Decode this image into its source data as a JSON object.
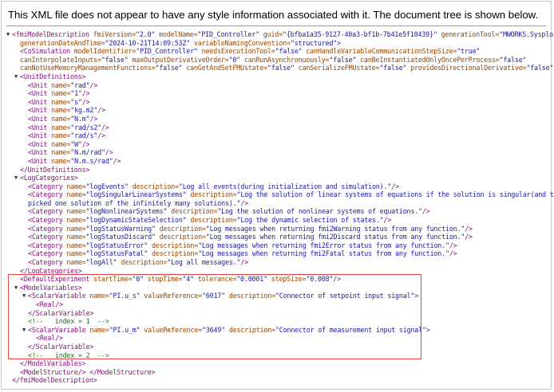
{
  "banner": "This XML file does not appear to have any style information associated with it. The document tree is shown below.",
  "lines": [
    {
      "indent": 0,
      "toggle": "▼",
      "parts": [
        [
          "tag",
          "<fmiModelDescription "
        ],
        [
          "an",
          "fmiVersion="
        ],
        [
          "av",
          "\"2.0\""
        ],
        [
          "an",
          " modelName="
        ],
        [
          "av",
          "\"PID_Controller\""
        ],
        [
          "an",
          " guid="
        ],
        [
          "av",
          "\"{bfba1a35-9127-40a3-bf1b-7b41e5f10439}\""
        ],
        [
          "an",
          " generationTool="
        ],
        [
          "av",
          "\"MWORKS.Sysplorer\""
        ]
      ]
    },
    {
      "indent": 1,
      "toggle": "",
      "parts": [
        [
          "an",
          "generationDateAndTime="
        ],
        [
          "av",
          "\"2024-10-21T14:09:53Z\""
        ],
        [
          "an",
          " variableNamingConvention="
        ],
        [
          "av",
          "\"structured\""
        ],
        [
          "tag",
          ">"
        ]
      ]
    },
    {
      "indent": 1,
      "toggle": "",
      "parts": [
        [
          "tag",
          "<CoSimulation "
        ],
        [
          "an",
          "modelIdentifier="
        ],
        [
          "av",
          "\"PID_Controller\""
        ],
        [
          "an",
          " needsExecutionTool="
        ],
        [
          "av",
          "\"false\""
        ],
        [
          "an",
          " canHandleVariableCommunicationStepSize="
        ],
        [
          "av",
          "\"true\""
        ]
      ]
    },
    {
      "indent": 1,
      "toggle": "",
      "parts": [
        [
          "an",
          "canInterpolateInputs="
        ],
        [
          "av",
          "\"false\""
        ],
        [
          "an",
          " maxOutputDerivativeOrder="
        ],
        [
          "av",
          "\"0\""
        ],
        [
          "an",
          " canRunAsynchronuously="
        ],
        [
          "av",
          "\"false\""
        ],
        [
          "an",
          " canBeInstantiatedOnlyOncePerProcess="
        ],
        [
          "av",
          "\"false\""
        ]
      ]
    },
    {
      "indent": 1,
      "toggle": "",
      "parts": [
        [
          "an",
          "canNotUseMemoryManagementFunctions="
        ],
        [
          "av",
          "\"false\""
        ],
        [
          "an",
          " canGetAndSetFMUstate="
        ],
        [
          "av",
          "\"false\""
        ],
        [
          "an",
          " canSerializeFMUstate="
        ],
        [
          "av",
          "\"false\""
        ],
        [
          "an",
          " providesDirectionalDerivative="
        ],
        [
          "av",
          "\"false\""
        ],
        [
          "tag",
          "/>"
        ]
      ]
    },
    {
      "indent": 1,
      "toggle": "▼",
      "parts": [
        [
          "tag",
          "<UnitDefinitions>"
        ]
      ]
    },
    {
      "indent": 2,
      "toggle": "",
      "parts": [
        [
          "tag",
          "<Unit "
        ],
        [
          "an",
          "name="
        ],
        [
          "av",
          "\"rad\""
        ],
        [
          "tag",
          "/>"
        ]
      ]
    },
    {
      "indent": 2,
      "toggle": "",
      "parts": [
        [
          "tag",
          "<Unit "
        ],
        [
          "an",
          "name="
        ],
        [
          "av",
          "\"1\""
        ],
        [
          "tag",
          "/>"
        ]
      ]
    },
    {
      "indent": 2,
      "toggle": "",
      "parts": [
        [
          "tag",
          "<Unit "
        ],
        [
          "an",
          "name="
        ],
        [
          "av",
          "\"s\""
        ],
        [
          "tag",
          "/>"
        ]
      ]
    },
    {
      "indent": 2,
      "toggle": "",
      "parts": [
        [
          "tag",
          "<Unit "
        ],
        [
          "an",
          "name="
        ],
        [
          "av",
          "\"kg.m2\""
        ],
        [
          "tag",
          "/>"
        ]
      ]
    },
    {
      "indent": 2,
      "toggle": "",
      "parts": [
        [
          "tag",
          "<Unit "
        ],
        [
          "an",
          "name="
        ],
        [
          "av",
          "\"N.m\""
        ],
        [
          "tag",
          "/>"
        ]
      ]
    },
    {
      "indent": 2,
      "toggle": "",
      "parts": [
        [
          "tag",
          "<Unit "
        ],
        [
          "an",
          "name="
        ],
        [
          "av",
          "\"rad/s2\""
        ],
        [
          "tag",
          "/>"
        ]
      ]
    },
    {
      "indent": 2,
      "toggle": "",
      "parts": [
        [
          "tag",
          "<Unit "
        ],
        [
          "an",
          "name="
        ],
        [
          "av",
          "\"rad/s\""
        ],
        [
          "tag",
          "/>"
        ]
      ]
    },
    {
      "indent": 2,
      "toggle": "",
      "parts": [
        [
          "tag",
          "<Unit "
        ],
        [
          "an",
          "name="
        ],
        [
          "av",
          "\"W\""
        ],
        [
          "tag",
          "/>"
        ]
      ]
    },
    {
      "indent": 2,
      "toggle": "",
      "parts": [
        [
          "tag",
          "<Unit "
        ],
        [
          "an",
          "name="
        ],
        [
          "av",
          "\"N.m/rad\""
        ],
        [
          "tag",
          "/>"
        ]
      ]
    },
    {
      "indent": 2,
      "toggle": "",
      "parts": [
        [
          "tag",
          "<Unit "
        ],
        [
          "an",
          "name="
        ],
        [
          "av",
          "\"N.m.s/rad\""
        ],
        [
          "tag",
          "/>"
        ]
      ]
    },
    {
      "indent": 1,
      "toggle": "",
      "parts": [
        [
          "tag",
          "</UnitDefinitions>"
        ]
      ]
    },
    {
      "indent": 1,
      "toggle": "▼",
      "parts": [
        [
          "tag",
          "<LogCategories>"
        ]
      ]
    },
    {
      "indent": 2,
      "toggle": "",
      "parts": [
        [
          "tag",
          "<Category "
        ],
        [
          "an",
          "name="
        ],
        [
          "av",
          "\"logEvents\""
        ],
        [
          "an",
          " description="
        ],
        [
          "av",
          "\"Log all events(during initialization and simulation).\""
        ],
        [
          "tag",
          "/>"
        ]
      ]
    },
    {
      "indent": 2,
      "toggle": "",
      "parts": [
        [
          "tag",
          "<Category "
        ],
        [
          "an",
          "name="
        ],
        [
          "av",
          "\"logSingularLinearSystems\""
        ],
        [
          "an",
          " description="
        ],
        [
          "av",
          "\"Log the solution of linear systems of equations if the solution is singular(and the tool"
        ]
      ]
    },
    {
      "indent": 2,
      "toggle": "",
      "parts": [
        [
          "av",
          "picked one solution of the infinitely many solutions).\""
        ],
        [
          "tag",
          "/>"
        ]
      ]
    },
    {
      "indent": 2,
      "toggle": "",
      "parts": [
        [
          "tag",
          "<Category "
        ],
        [
          "an",
          "name="
        ],
        [
          "av",
          "\"logNonlinearSystems\""
        ],
        [
          "an",
          " description="
        ],
        [
          "av",
          "\"Log the solution of nonlinear systems of equations.\""
        ],
        [
          "tag",
          "/>"
        ]
      ]
    },
    {
      "indent": 2,
      "toggle": "",
      "parts": [
        [
          "tag",
          "<Category "
        ],
        [
          "an",
          "name="
        ],
        [
          "av",
          "\"logDynamicStateSelection\""
        ],
        [
          "an",
          " description="
        ],
        [
          "av",
          "\"Log the dynamic selection of states.\""
        ],
        [
          "tag",
          "/>"
        ]
      ]
    },
    {
      "indent": 2,
      "toggle": "",
      "parts": [
        [
          "tag",
          "<Category "
        ],
        [
          "an",
          "name="
        ],
        [
          "av",
          "\"logStatusWarning\""
        ],
        [
          "an",
          " description="
        ],
        [
          "av",
          "\"Log messages when returning fmi2Warning status from any function.\""
        ],
        [
          "tag",
          "/>"
        ]
      ]
    },
    {
      "indent": 2,
      "toggle": "",
      "parts": [
        [
          "tag",
          "<Category "
        ],
        [
          "an",
          "name="
        ],
        [
          "av",
          "\"logStatusDiscard\""
        ],
        [
          "an",
          " description="
        ],
        [
          "av",
          "\"Log messages when returning fmi2Discard status from any function.\""
        ],
        [
          "tag",
          "/>"
        ]
      ]
    },
    {
      "indent": 2,
      "toggle": "",
      "parts": [
        [
          "tag",
          "<Category "
        ],
        [
          "an",
          "name="
        ],
        [
          "av",
          "\"logStatusError\""
        ],
        [
          "an",
          " description="
        ],
        [
          "av",
          "\"Log messages when returning fmi2Error status from any function.\""
        ],
        [
          "tag",
          "/>"
        ]
      ]
    },
    {
      "indent": 2,
      "toggle": "",
      "parts": [
        [
          "tag",
          "<Category "
        ],
        [
          "an",
          "name="
        ],
        [
          "av",
          "\"logStatusFatal\""
        ],
        [
          "an",
          " description="
        ],
        [
          "av",
          "\"Log messages when returning fmi2Fatal status from any function.\""
        ],
        [
          "tag",
          "/>"
        ]
      ]
    },
    {
      "indent": 2,
      "toggle": "",
      "parts": [
        [
          "tag",
          "<Category "
        ],
        [
          "an",
          "name="
        ],
        [
          "av",
          "\"logAll\""
        ],
        [
          "an",
          " description="
        ],
        [
          "av",
          "\"Log all messages.\""
        ],
        [
          "tag",
          "/>"
        ]
      ]
    },
    {
      "indent": 1,
      "toggle": "",
      "parts": [
        [
          "tag",
          "</LogCategories>"
        ]
      ]
    },
    {
      "indent": 1,
      "toggle": "",
      "parts": [
        [
          "tag",
          "<DefaultExperiment "
        ],
        [
          "an",
          "startTime="
        ],
        [
          "av",
          "\"0\""
        ],
        [
          "an",
          " stopTime="
        ],
        [
          "av",
          "\"4\""
        ],
        [
          "an",
          " tolerance="
        ],
        [
          "av",
          "\"0.0001\""
        ],
        [
          "an",
          " stepSize="
        ],
        [
          "av",
          "\"0.008\""
        ],
        [
          "tag",
          "/>"
        ]
      ]
    },
    {
      "indent": 1,
      "toggle": "▼",
      "parts": [
        [
          "tag",
          "<ModelVariables>"
        ]
      ]
    },
    {
      "indent": 2,
      "toggle": "▼",
      "parts": [
        [
          "tag",
          "<ScalarVariable "
        ],
        [
          "an",
          "name="
        ],
        [
          "av",
          "\"PI.u_s\""
        ],
        [
          "an",
          " valueReference="
        ],
        [
          "av",
          "\"6017\""
        ],
        [
          "an",
          " description="
        ],
        [
          "av",
          "\"Connector of setpoint input signal\""
        ],
        [
          "tag",
          ">"
        ]
      ]
    },
    {
      "indent": 3,
      "toggle": "",
      "parts": [
        [
          "tag",
          "<Real/>"
        ]
      ]
    },
    {
      "indent": 2,
      "toggle": "",
      "parts": [
        [
          "tag",
          "</ScalarVariable>"
        ]
      ]
    },
    {
      "indent": 2,
      "toggle": "",
      "parts": [
        [
          "cm",
          "<!--   index = 1  -->"
        ]
      ]
    },
    {
      "indent": 2,
      "toggle": "▼",
      "parts": [
        [
          "tag",
          "<ScalarVariable "
        ],
        [
          "an",
          "name="
        ],
        [
          "av",
          "\"PI.u_m\""
        ],
        [
          "an",
          " valueReference="
        ],
        [
          "av",
          "\"3649\""
        ],
        [
          "an",
          " description="
        ],
        [
          "av",
          "\"Connector of measurement input signal\""
        ],
        [
          "tag",
          ">"
        ]
      ]
    },
    {
      "indent": 3,
      "toggle": "",
      "parts": [
        [
          "tag",
          "<Real/>"
        ]
      ]
    },
    {
      "indent": 2,
      "toggle": "",
      "parts": [
        [
          "tag",
          "</ScalarVariable>"
        ]
      ]
    },
    {
      "indent": 2,
      "toggle": "",
      "parts": [
        [
          "cm",
          "<!--   index = 2  -->"
        ]
      ]
    },
    {
      "indent": 1,
      "toggle": "",
      "parts": [
        [
          "tag",
          "</ModelVariables>"
        ]
      ]
    },
    {
      "indent": 1,
      "toggle": "",
      "parts": [
        [
          "tag",
          "<ModelStructure/>"
        ],
        [
          "tag",
          " </ModelStructure>"
        ]
      ]
    },
    {
      "indent": 0,
      "toggle": "",
      "parts": [
        [
          "tag",
          "</fmiModelDescription>"
        ]
      ]
    }
  ],
  "highlight_color": "#e2413c"
}
